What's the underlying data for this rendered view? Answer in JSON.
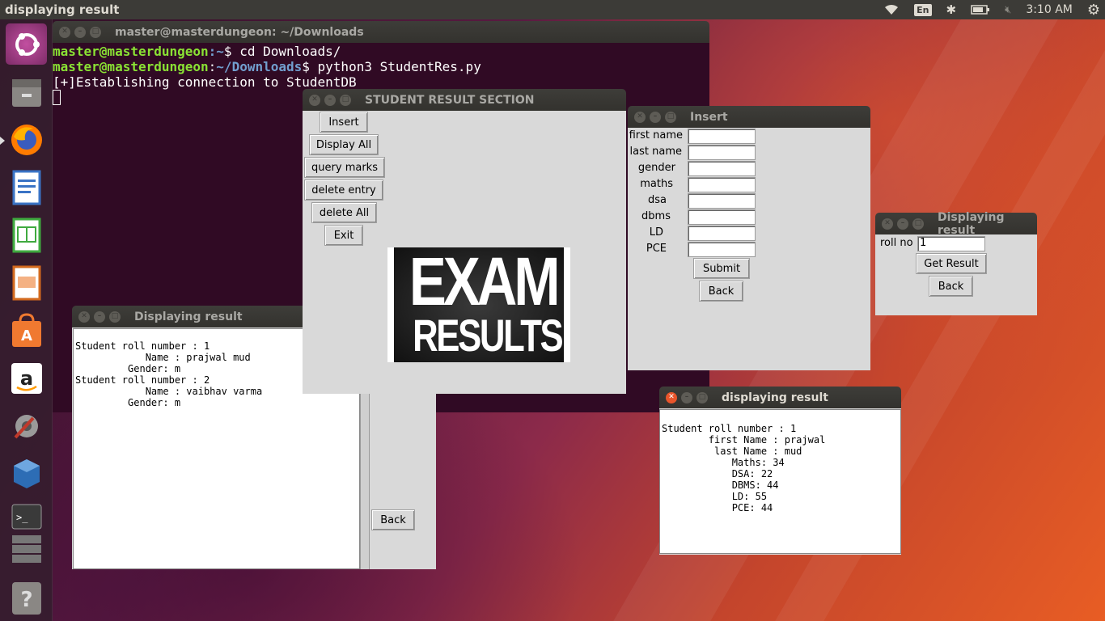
{
  "top_panel": {
    "active_title": "displaying result",
    "keyboard_layout": "En",
    "clock": "3:10 AM"
  },
  "launcher": {
    "items": [
      "ubuntu-dash-icon",
      "files-icon",
      "firefox-icon",
      "writer-icon",
      "calc-icon",
      "impress-icon",
      "software-center-icon",
      "amazon-icon",
      "settings-icon",
      "virtualbox-icon",
      "terminal-icon",
      "workspace-icon",
      "help-icon"
    ]
  },
  "terminal": {
    "title": "master@masterdungeon: ~/Downloads",
    "line1_user": "master@masterdungeon",
    "line1_path": ":~",
    "line1_cmd": "$ cd Downloads/",
    "line2_user": "master@masterdungeon",
    "line2_path_sep": ":",
    "line2_path": "~/Downloads",
    "line2_cmd": "$ python3 StudentRes.py",
    "line3": "[+]Establishing connection to StudentDB"
  },
  "main_window": {
    "title": "STUDENT RESULT SECTION",
    "buttons": {
      "insert": "Insert",
      "display_all": "Display All",
      "query_marks": "query marks",
      "delete_entry": "delete entry",
      "delete_all": "delete All",
      "exit": "Exit"
    },
    "banner": {
      "line1": "EXAM",
      "line2": "RESULTS"
    }
  },
  "insert_window": {
    "title": "Insert",
    "fields": {
      "first_name": "first name",
      "last_name": "last name",
      "gender": "gender",
      "maths": "maths",
      "dsa": "dsa",
      "dbms": "dbms",
      "ld": "LD",
      "pce": "PCE"
    },
    "submit": "Submit",
    "back": "Back"
  },
  "display_all_window": {
    "title": "Displaying result",
    "text": "Student roll number : 1\n            Name : prajwal mud\n         Gender: m\nStudent roll number : 2\n            Name : vaibhav varma\n         Gender: m",
    "back": "Back"
  },
  "query_window": {
    "title": "Displaying result",
    "roll_label": "roll no",
    "roll_value": "1",
    "get_result": "Get Result",
    "back": "Back"
  },
  "result_window": {
    "title": "displaying result",
    "text": "Student roll number : 1\n        first Name : prajwal\n         last Name : mud\n            Maths: 34\n            DSA: 22\n            DBMS: 44\n            LD: 55\n            PCE: 44"
  }
}
